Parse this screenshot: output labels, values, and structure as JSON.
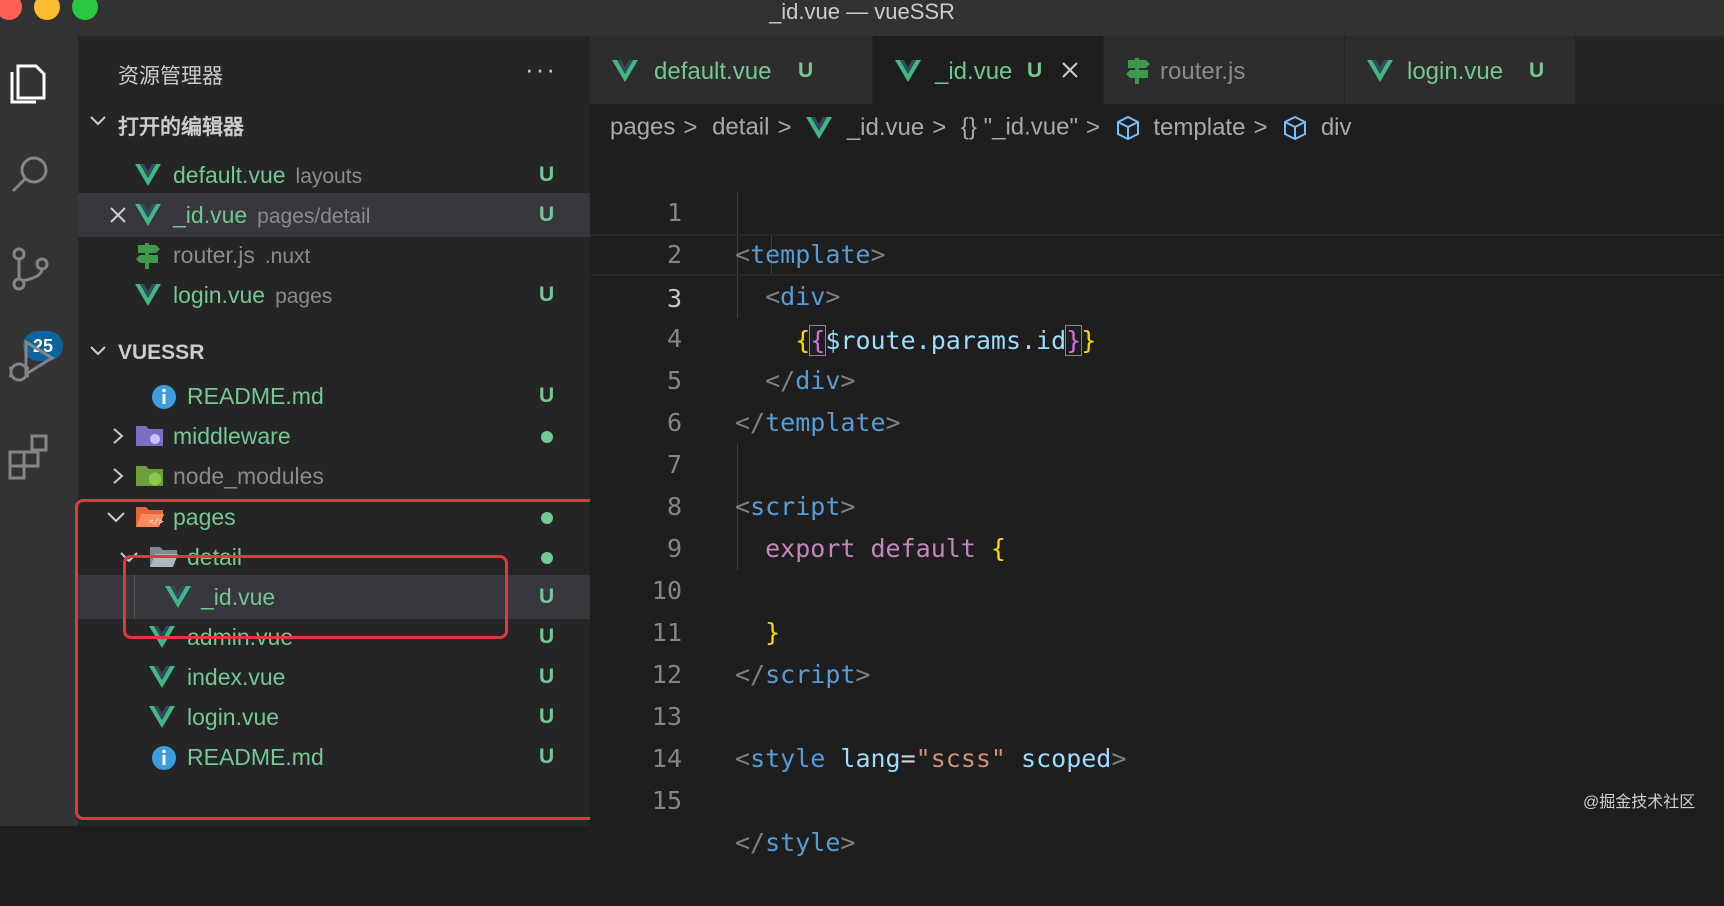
{
  "window": {
    "title": "_id.vue — vueSSR"
  },
  "activity_bar": {
    "icons": [
      "explorer-icon",
      "search-icon",
      "source-control-icon",
      "run-debug-icon",
      "extensions-icon"
    ],
    "scm_badge": "25"
  },
  "sidebar": {
    "title": "资源管理器",
    "more": "···",
    "open_editors": {
      "label": "打开的编辑器",
      "items": [
        {
          "name": "default.vue",
          "desc": "layouts",
          "status": "U"
        },
        {
          "name": "_id.vue",
          "desc": "pages/detail",
          "status": "U"
        },
        {
          "name": "router.js",
          "desc": ".nuxt",
          "status": ""
        },
        {
          "name": "login.vue",
          "desc": "pages",
          "status": "U"
        }
      ]
    },
    "workspace": {
      "label": "VUESSR",
      "items": [
        {
          "name": "README.md",
          "status": "U"
        },
        {
          "name": "middleware",
          "status": "●"
        },
        {
          "name": "node_modules",
          "status": ""
        },
        {
          "name": "pages",
          "status": "●"
        },
        {
          "name": "detail",
          "status": "●"
        },
        {
          "name": "_id.vue",
          "status": "U"
        },
        {
          "name": "admin.vue",
          "status": "U"
        },
        {
          "name": "index.vue",
          "status": "U"
        },
        {
          "name": "login.vue",
          "status": "U"
        },
        {
          "name": "README.md",
          "status": "U"
        }
      ]
    }
  },
  "tabs": [
    {
      "name": "default.vue",
      "status": "U"
    },
    {
      "name": "_id.vue",
      "status": "U"
    },
    {
      "name": "router.js",
      "status": ""
    },
    {
      "name": "login.vue",
      "status": "U"
    }
  ],
  "breadcrumb": [
    "pages",
    "detail",
    "_id.vue",
    "{} \"_id.vue\"",
    "template",
    "div"
  ],
  "editor": {
    "current_line": "3",
    "lines": [
      "1",
      "2",
      "3",
      "4",
      "5",
      "6",
      "7",
      "8",
      "9",
      "10",
      "11",
      "12",
      "13",
      "14",
      "15"
    ],
    "code": {
      "l1_tag": "template",
      "l2_tag": "div",
      "l3_expr": "$route.params.id",
      "l4_tag": "div",
      "l5_tag": "template",
      "l7_tag": "script",
      "l8_kw1": "export",
      "l8_kw2": "default",
      "l11_tag": "script",
      "l13_tag": "style",
      "l13_attr": "lang",
      "l13_val": "\"scss\"",
      "l13_attr2": "scoped",
      "l15_tag": "style"
    }
  },
  "watermark": "@掘金技术社区",
  "colors": {
    "git_untracked": "#73c991",
    "highlight_box": "#e0383e",
    "vue_logo": "#41b883"
  }
}
